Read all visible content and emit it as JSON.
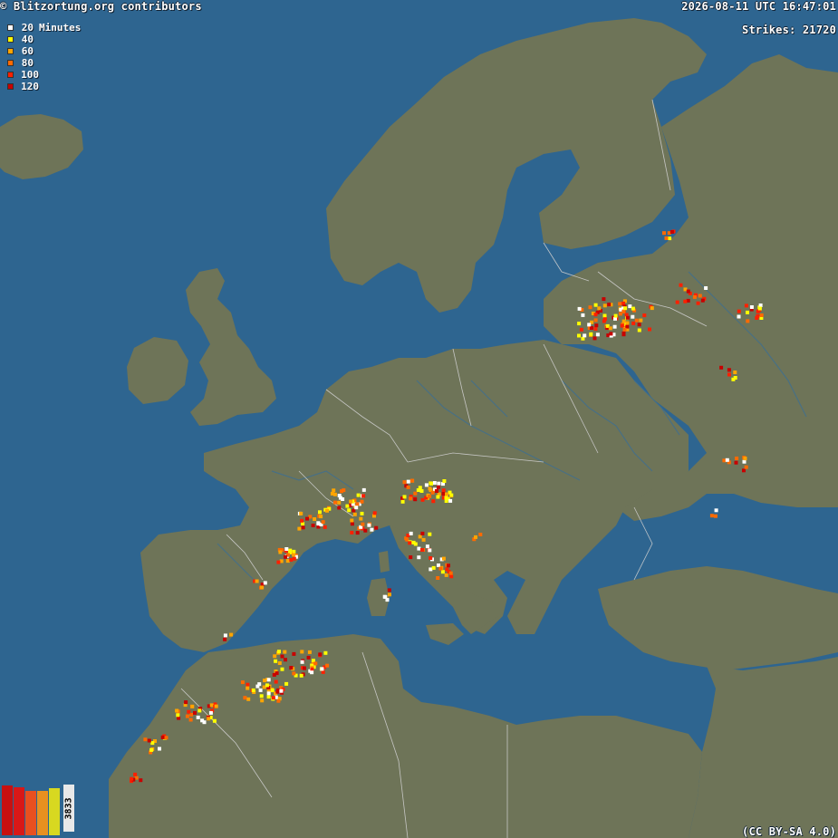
{
  "header": {
    "copyright": "© Blitzortung.org contributors",
    "timestamp": "2026-08-11 UTC 16:47:01",
    "strikes": "Strikes: 21720"
  },
  "legend": {
    "unit": "Minutes",
    "items": [
      {
        "value": "20",
        "color": "#ffffff"
      },
      {
        "value": "40",
        "color": "#ffff00"
      },
      {
        "value": "60",
        "color": "#ffa500"
      },
      {
        "value": "80",
        "color": "#ff6a00"
      },
      {
        "value": "100",
        "color": "#ff2000"
      },
      {
        "value": "120",
        "color": "#c80000"
      }
    ]
  },
  "histogram": {
    "count": "3833",
    "colors": [
      "#c81010",
      "#d81818",
      "#e85020",
      "#e89020",
      "#d8d820",
      "#e8e8e8"
    ],
    "levels": [
      0.95,
      0.92,
      0.85,
      0.85,
      0.9,
      0.85
    ]
  },
  "footer": {
    "license": "(CC BY-SA 4.0)"
  },
  "colors": {
    "sea": "#2e6590",
    "land": "#6e7458",
    "border": "#cfcfcf",
    "river": "#3f6f90"
  }
}
